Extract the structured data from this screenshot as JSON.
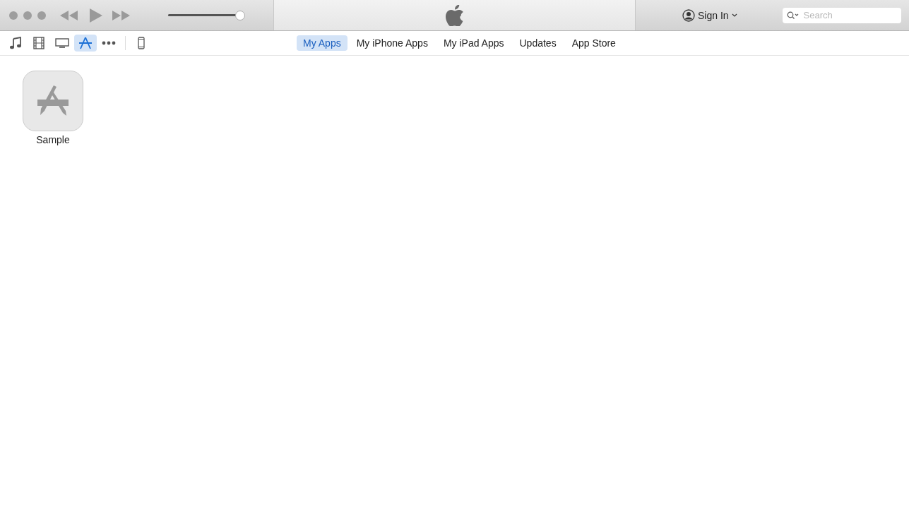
{
  "player": {
    "volume": {
      "level": 1.0
    }
  },
  "account": {
    "label": "Sign In"
  },
  "search": {
    "placeholder": "Search"
  },
  "media_kinds": [
    {
      "kind": "music",
      "selected": false
    },
    {
      "kind": "movie",
      "selected": false
    },
    {
      "kind": "tv",
      "selected": false
    },
    {
      "kind": "apps",
      "selected": true
    },
    {
      "kind": "more",
      "selected": false
    },
    {
      "kind": "device",
      "selected": false
    }
  ],
  "tabs": [
    {
      "label": "My Apps",
      "selected": true
    },
    {
      "label": "My iPhone Apps",
      "selected": false
    },
    {
      "label": "My iPad Apps",
      "selected": false
    },
    {
      "label": "Updates",
      "selected": false
    },
    {
      "label": "App Store",
      "selected": false
    }
  ],
  "apps": [
    {
      "name": "Sample"
    }
  ]
}
